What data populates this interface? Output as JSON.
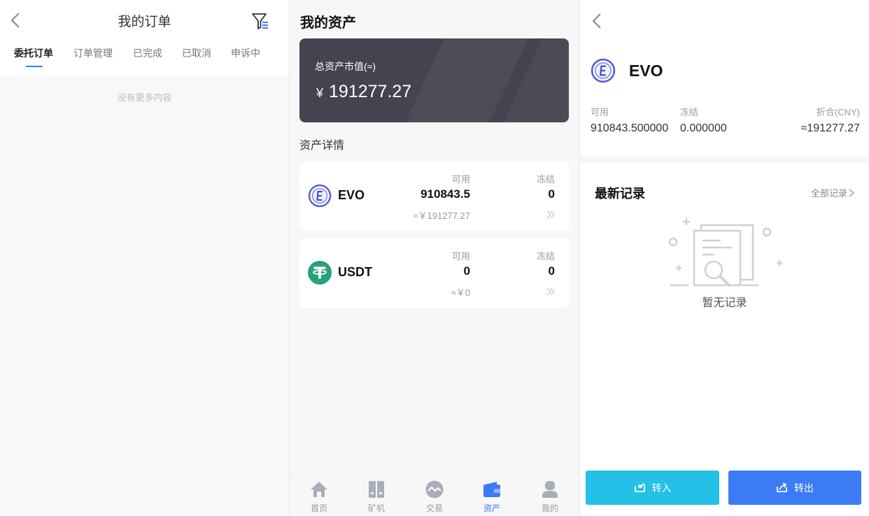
{
  "orders": {
    "title": "我的订单",
    "tabs": [
      {
        "label": "委托订单"
      },
      {
        "label": "订单管理"
      },
      {
        "label": "已完成"
      },
      {
        "label": "已取消"
      },
      {
        "label": "申诉中"
      }
    ],
    "empty_text": "没有更多内容"
  },
  "assets": {
    "title": "我的资产",
    "total_label": "总资产市值(≈)",
    "total_currency": "¥",
    "total_value": "191277.27",
    "detail_title": "资产详情",
    "cards": [
      {
        "name": "EVO",
        "avail_label": "可用",
        "frozen_label": "冻结",
        "avail": "910843.5",
        "frozen": "0",
        "cny": "≈￥191277.27",
        "icon": "evo-coin-icon"
      },
      {
        "name": "USDT",
        "avail_label": "可用",
        "frozen_label": "冻结",
        "avail": "0",
        "frozen": "0",
        "cny": "≈￥0",
        "icon": "usdt-coin-icon"
      }
    ],
    "tabbar": [
      {
        "label": "首页",
        "icon": "home-icon"
      },
      {
        "label": "矿机",
        "icon": "miner-icon"
      },
      {
        "label": "交易",
        "icon": "trade-icon"
      },
      {
        "label": "资产",
        "icon": "wallet-icon",
        "active": true
      },
      {
        "label": "我的",
        "icon": "user-icon"
      }
    ],
    "active_color": "#3b7cf6"
  },
  "detail": {
    "coin_name": "EVO",
    "avail_label": "可用",
    "frozen_label": "冻结",
    "cny_label": "折合(CNY)",
    "avail": "910843.500000",
    "frozen": "0.000000",
    "cny": "≈191277.27",
    "records_title": "最新记录",
    "all_records": "全部记录",
    "no_records": "暂无记录",
    "transfer_in": "转入",
    "transfer_out": "转出",
    "colors": {
      "transfer_in": "#24c0e8",
      "transfer_out": "#3b7cf6"
    }
  }
}
